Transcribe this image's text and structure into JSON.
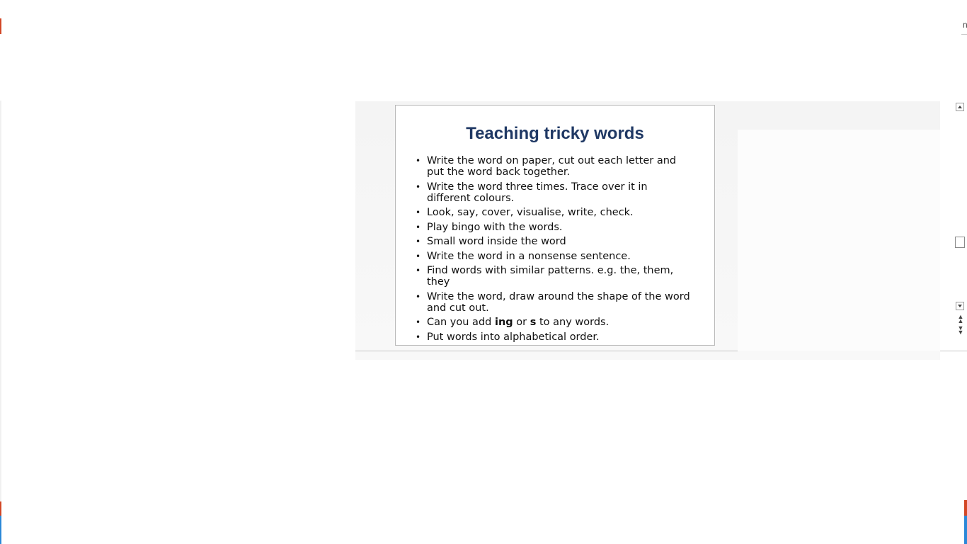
{
  "window": {
    "top_right_glyph": "n"
  },
  "slide": {
    "title": "Teaching tricky words",
    "bullets": [
      {
        "parts": [
          {
            "text": "Write the word on paper, cut out each letter and put the word back together."
          }
        ]
      },
      {
        "parts": [
          {
            "text": "Write the word three times.  Trace over it in different colours."
          }
        ]
      },
      {
        "parts": [
          {
            "text": "Look, say, cover, visualise, write, check."
          }
        ]
      },
      {
        "parts": [
          {
            "text": "Play bingo with the words."
          }
        ]
      },
      {
        "parts": [
          {
            "text": "Small word inside the word"
          }
        ]
      },
      {
        "parts": [
          {
            "text": "Write the word in a nonsense sentence."
          }
        ]
      },
      {
        "parts": [
          {
            "text": "Find words with similar patterns. e.g. the, them, they"
          }
        ]
      },
      {
        "parts": [
          {
            "text": "Write the word, draw around the shape of the word and cut out."
          }
        ]
      },
      {
        "parts": [
          {
            "text": "Can you add "
          },
          {
            "text": "ing",
            "bold": true
          },
          {
            "text": " or "
          },
          {
            "text": "s",
            "bold": true
          },
          {
            "text": " to any words."
          }
        ]
      },
      {
        "parts": [
          {
            "text": "Put words into alphabetical order."
          }
        ]
      }
    ],
    "title_color": "#1f3864"
  },
  "scrollbar": {
    "up_icon": "scroll-up-arrow-icon",
    "down_icon": "scroll-down-arrow-icon",
    "prev_icon": "previous-slide-icon",
    "next_icon": "next-slide-icon"
  },
  "colors": {
    "accent_orange": "#d24726",
    "accent_blue": "#2b88d8"
  }
}
